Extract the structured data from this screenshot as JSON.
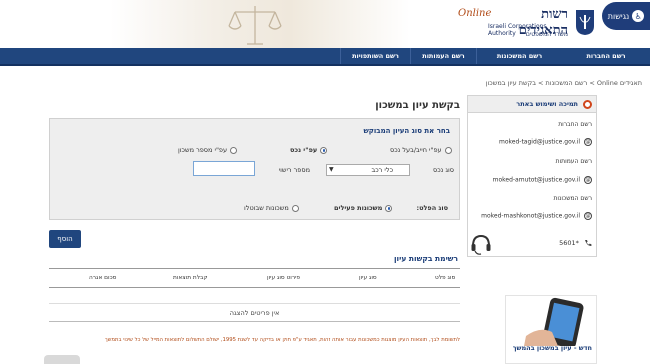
{
  "header": {
    "accessibility_label": "נגישות",
    "title_hebrew": "רשות התאגידים",
    "online_tag": "Online",
    "title_english": "Israeli Corporations Authority",
    "ministry": "משרד המשפטים"
  },
  "nav": {
    "items": [
      {
        "label": "רשם החברות"
      },
      {
        "label": "רשם המשכונות"
      },
      {
        "label": "רשם העמותות"
      },
      {
        "label": "רשם השותפויות"
      }
    ]
  },
  "breadcrumb": "תאגידים Online > רשם המשכונות > בקשת עיון במשכון",
  "page_title": "בקשת עיון במשכון",
  "sidebar": {
    "support_title": "תמיכה ושימוש באתר",
    "sections": [
      {
        "label": "רשם החברות",
        "email": "moked-tagid@justice.gov.il"
      },
      {
        "label": "רשם העמותות",
        "email": "moked-amutot@justice.gov.il"
      },
      {
        "label": "רשם המשכונות",
        "email": "moked-mashkonot@justice.gov.il"
      }
    ],
    "phone": "*5601"
  },
  "form": {
    "title": "בחר את סוג העיון המבוקש",
    "search_by": [
      {
        "label": "עפ\"י חייב/בעל נכס",
        "selected": false
      },
      {
        "label": "עפ\"י נכס",
        "selected": true
      },
      {
        "label": "עפ\"י מספר משכון",
        "selected": false
      }
    ],
    "asset_type_label": "סוג נכס",
    "asset_type_value": "כלי רכב",
    "license_label": "מספר רישוי",
    "license_value": "",
    "filter_label": "סוג הפלט:",
    "filter_options": [
      {
        "label": "משכונות פעילים",
        "selected": true
      },
      {
        "label": "משכונות שבוטלו",
        "selected": false
      }
    ],
    "add_button": "הוסף"
  },
  "requests": {
    "title": "רשימת בקשות עיון",
    "columns": [
      "סוג פלט",
      "סוג עיון",
      "פירוט סוג עיון",
      "קבלת תוצאות",
      "סכום אגרה"
    ],
    "rows": [],
    "empty_message": "אין פריטים להצגה"
  },
  "footnote": "לתשומת לבך, תוצאות העיון מוצגות כמשכונות עבור אותה זהות, תאגיד ע\"פ חוק או בדיקה עד לשנת 1995, ישולם התשלום לתוצאות המייל של כל שינוי בתמשך",
  "promo": {
    "text": "חדש - עיון במשכון בהמשך"
  }
}
